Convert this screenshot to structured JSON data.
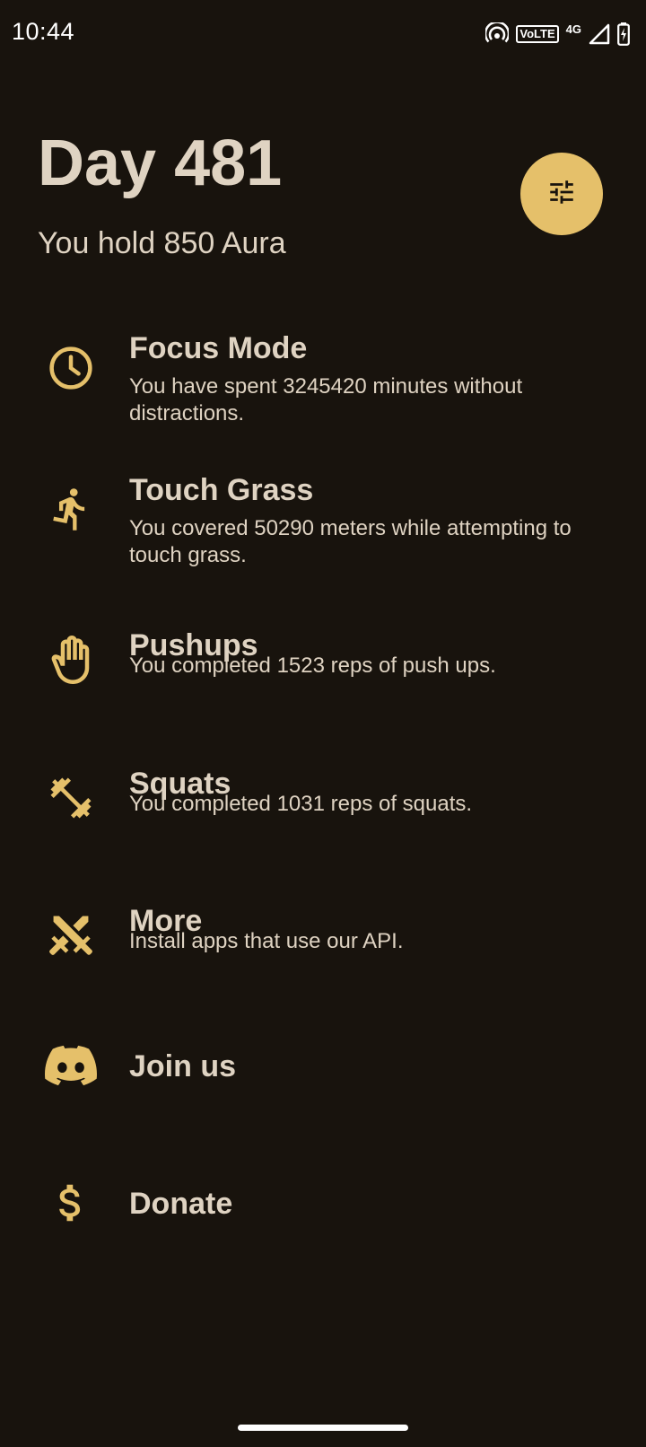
{
  "status_bar": {
    "time": "10:44",
    "volte": "VoLTE",
    "network": "4G",
    "icons": [
      "hotspot-icon",
      "volte-icon",
      "signal-icon",
      "battery-charging-icon"
    ]
  },
  "header": {
    "day_title": "Day 481",
    "aura_text": "You hold 850 Aura",
    "settings_icon": "tune-icon"
  },
  "menu": {
    "items": [
      {
        "icon": "clock-icon",
        "title": "Focus Mode",
        "description": "You have spent 3245420 minutes without distractions."
      },
      {
        "icon": "running-icon",
        "title": "Touch Grass",
        "description": "You covered 50290 meters while attempting to touch grass."
      },
      {
        "icon": "hand-icon",
        "title": "Pushups",
        "description": "You completed 1523 reps of push ups."
      },
      {
        "icon": "dumbbell-icon",
        "title": "Squats",
        "description": "You completed 1031 reps of squats."
      },
      {
        "icon": "swords-icon",
        "title": "More",
        "description": "Install apps that use our API."
      },
      {
        "icon": "discord-icon",
        "title": "Join us",
        "description": ""
      },
      {
        "icon": "dollar-icon",
        "title": "Donate",
        "description": ""
      }
    ]
  },
  "colors": {
    "background": "#18130d",
    "accent": "#e5c06a",
    "text": "#dfd3c2"
  }
}
